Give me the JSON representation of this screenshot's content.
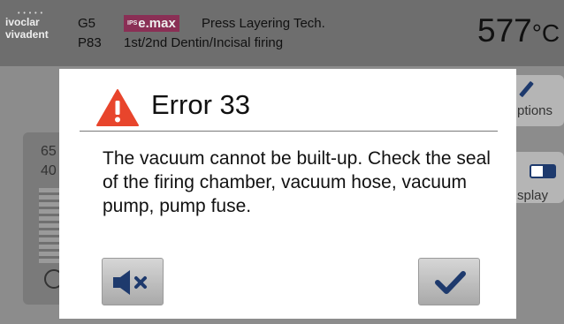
{
  "header": {
    "logo_line1": "ivoclar",
    "logo_line2": "vivadent",
    "program_group": "G5",
    "program_number": "P83",
    "material_badge_prefix": "IPS",
    "material_badge": "e.max",
    "title_line1": "Press Layering Tech.",
    "title_line2": "1st/2nd Dentin/Incisal firing",
    "temperature": "577",
    "temperature_unit": "°C"
  },
  "background": {
    "panel_value_top": "65",
    "panel_value_bottom": "40",
    "right_button_1_label": "ptions",
    "right_button_2_label": "splay"
  },
  "dialog": {
    "title": "Error 33",
    "message": "The vacuum cannot be built-up. Check the seal of the firing chamber, vacuum hose, vacuum pump, pump fuse.",
    "warning_icon": "warning-triangle-icon",
    "mute_button_icon": "speaker-mute-icon",
    "confirm_button_icon": "checkmark-icon",
    "colors": {
      "warning": "#e8452c",
      "icon_blue": "#1e3a6d"
    }
  }
}
